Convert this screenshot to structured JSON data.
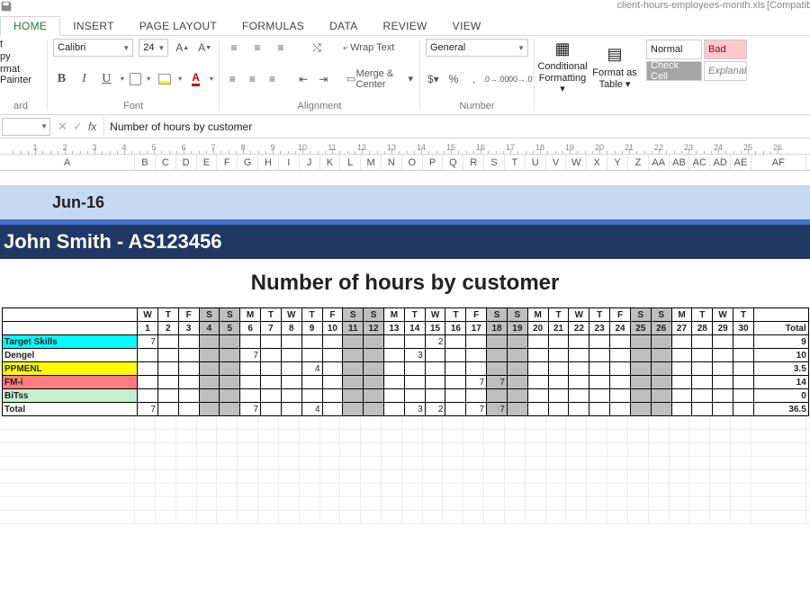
{
  "title": {
    "filename": "client-hours-employees-month.xls",
    "mode": "[Compatibility Mode"
  },
  "tabs": [
    "HOME",
    "INSERT",
    "PAGE LAYOUT",
    "FORMULAS",
    "DATA",
    "REVIEW",
    "VIEW"
  ],
  "ribbon": {
    "clipboard": {
      "copy": "py",
      "cut": "t",
      "painter": "rmat Painter",
      "group": "ard"
    },
    "font": {
      "name": "Calibri",
      "size": "24",
      "group": "Font"
    },
    "align": {
      "wrap": "Wrap Text",
      "merge": "Merge & Center",
      "group": "Alignment"
    },
    "number": {
      "format": "General",
      "group": "Number"
    },
    "cond": "Conditional Formatting ▾",
    "table": "Format as Table ▾",
    "styles": {
      "normal": "Normal",
      "bad": "Bad",
      "check": "Check Cell",
      "expl": "Explanator"
    }
  },
  "fx": {
    "label": "fx",
    "formula": "Number of hours by customer"
  },
  "ruler_max": 26,
  "columns": [
    "A",
    "B",
    "C",
    "D",
    "E",
    "F",
    "G",
    "H",
    "I",
    "J",
    "K",
    "L",
    "M",
    "N",
    "O",
    "P",
    "Q",
    "R",
    "S",
    "T",
    "U",
    "V",
    "W",
    "X",
    "Y",
    "Z",
    "AA",
    "AB",
    "AC",
    "AD",
    "AE",
    "AF"
  ],
  "sheet": {
    "month": "Jun-16",
    "person": "John Smith -  AS123456",
    "title": "Number of hours by customer",
    "days_weekday": [
      "W",
      "T",
      "F",
      "S",
      "S",
      "M",
      "T",
      "W",
      "T",
      "F",
      "S",
      "S",
      "M",
      "T",
      "W",
      "T",
      "F",
      "S",
      "S",
      "M",
      "T",
      "W",
      "T",
      "F",
      "S",
      "S",
      "M",
      "T",
      "W",
      "T"
    ],
    "days_num": [
      "1",
      "2",
      "3",
      "4",
      "5",
      "6",
      "7",
      "8",
      "9",
      "10",
      "11",
      "12",
      "13",
      "14",
      "15",
      "16",
      "17",
      "18",
      "19",
      "20",
      "21",
      "22",
      "23",
      "24",
      "25",
      "26",
      "27",
      "28",
      "29",
      "30"
    ],
    "weekends": [
      3,
      4,
      10,
      11,
      17,
      18,
      24,
      25
    ],
    "total_hdr": "Total",
    "rows": [
      {
        "label": "Target Skills",
        "cls": "c-target",
        "cells": {
          "0": "7",
          "14": "2"
        },
        "total": "9"
      },
      {
        "label": "Dengel",
        "cls": "c-dengel",
        "cells": {
          "5": "7",
          "13": "3"
        },
        "total": "10"
      },
      {
        "label": "PPMENL",
        "cls": "c-ppmenl",
        "cells": {
          "8": "4"
        },
        "total": "3.5"
      },
      {
        "label": "FM-i",
        "cls": "c-fmi",
        "cells": {
          "16": "7",
          "17": "7"
        },
        "total": "14"
      },
      {
        "label": "BiTss",
        "cls": "c-bitss",
        "cells": {},
        "total": "0"
      },
      {
        "label": "Total",
        "cls": "c-total",
        "cells": {
          "0": "7",
          "5": "7",
          "8": "4",
          "13": "3",
          "14": "2",
          "16": "7",
          "17": "7"
        },
        "total": "36.5"
      }
    ]
  }
}
